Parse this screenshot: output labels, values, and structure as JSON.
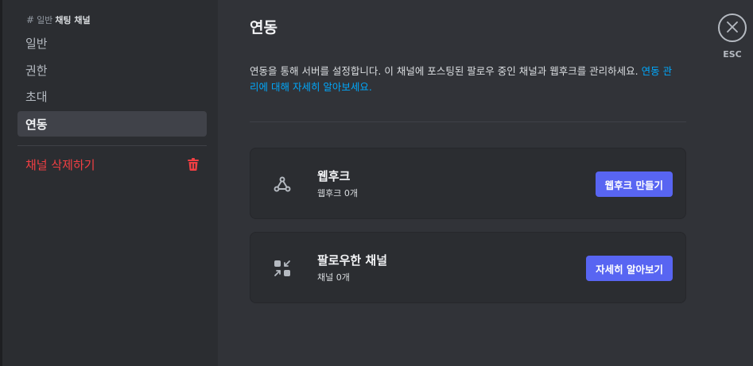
{
  "sidebar": {
    "header": {
      "hash": "#",
      "category": "일반",
      "channel": "채팅 채널"
    },
    "items": [
      {
        "label": "일반"
      },
      {
        "label": "권한"
      },
      {
        "label": "초대"
      },
      {
        "label": "연동"
      }
    ],
    "delete_label": "채널 삭제하기"
  },
  "main": {
    "title": "연동",
    "description": "연동을 통해 서버를 설정합니다. 이 채널에 포스팅된 팔로우 중인 채널과 웹후크를 관리하세요.",
    "description_link_line1": "연동 관",
    "description_line2": "리에 대해 자세히 알아보세요.",
    "webhooks": {
      "title": "웹후크",
      "subtitle": "웹후크 0개",
      "button": "웹후크 만들기",
      "icon": "webhook-icon"
    },
    "followed": {
      "title": "팔로우한 채널",
      "subtitle": "채널 0개",
      "button": "자세히 알아보기",
      "icon": "follow-icon"
    }
  },
  "close": {
    "label": "ESC"
  },
  "colors": {
    "accent": "#5865f2",
    "danger": "#f23f43",
    "link": "#00a8fc"
  }
}
